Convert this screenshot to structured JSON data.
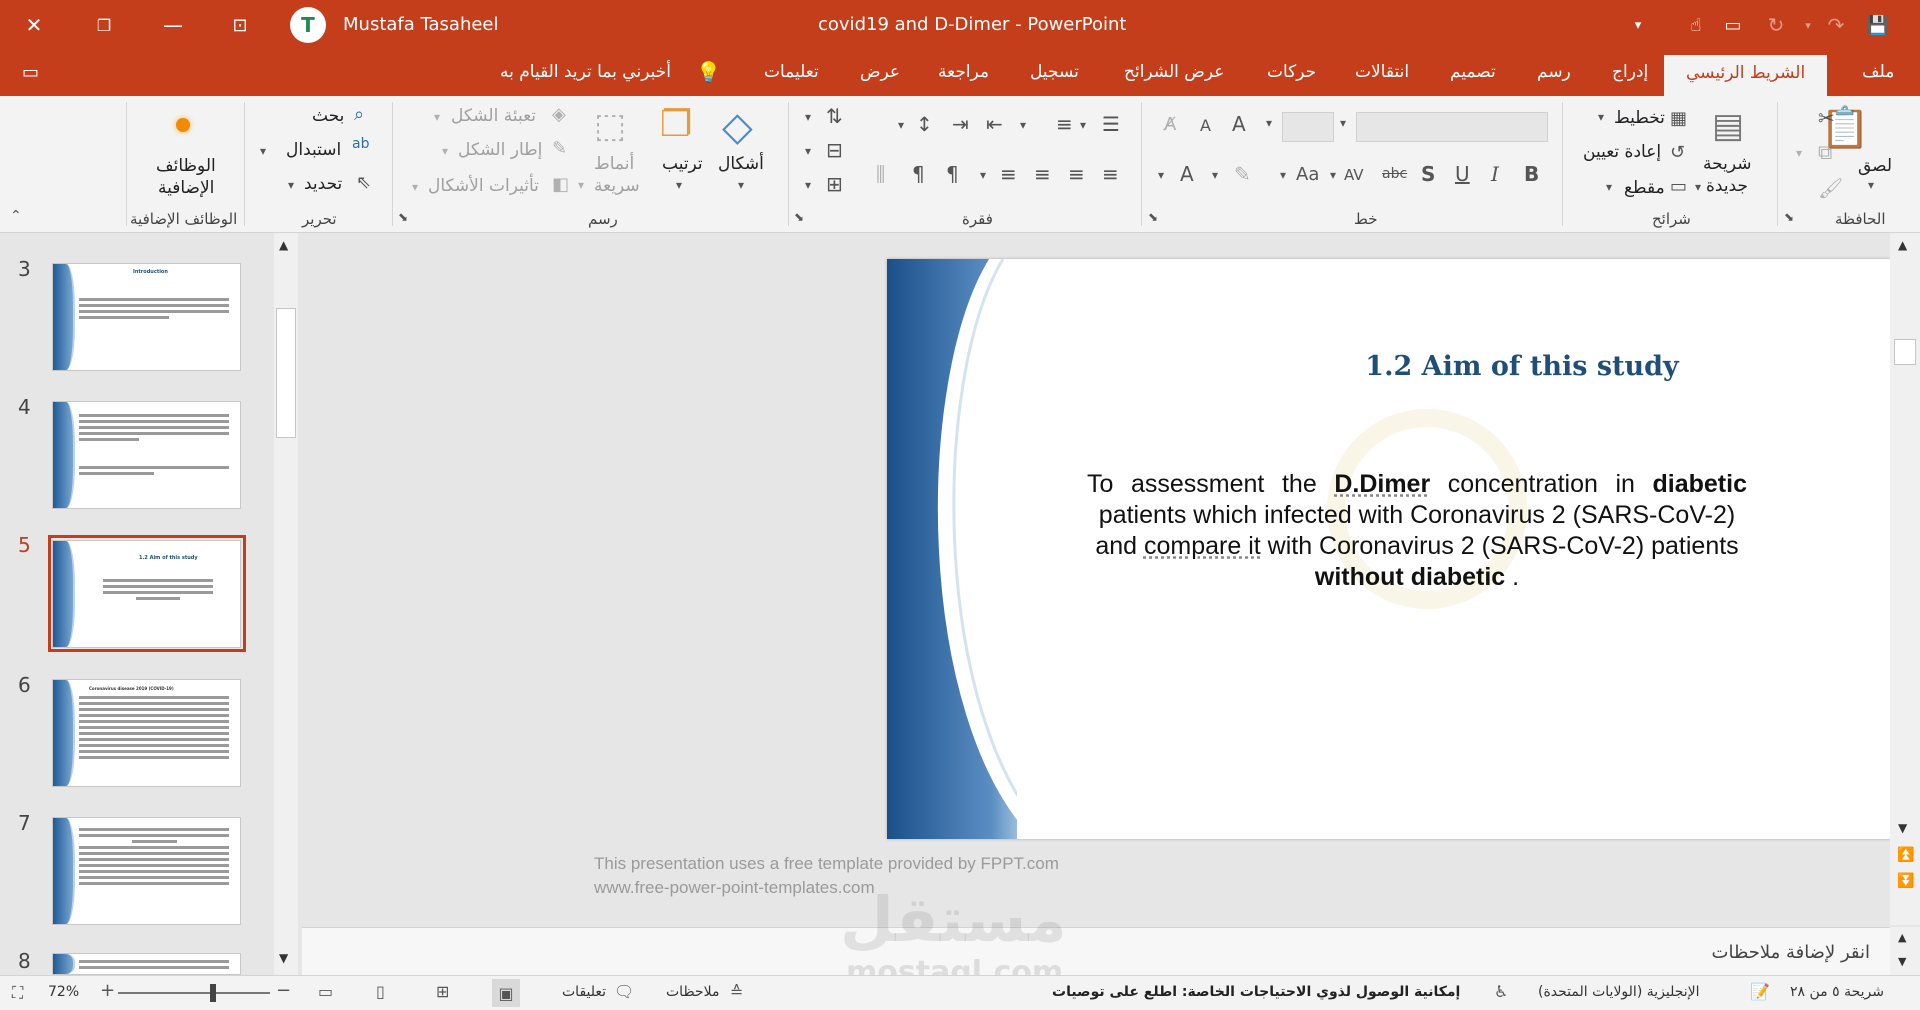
{
  "window": {
    "title": "covid19 and D-Dimer  -  PowerPoint",
    "user": "Mustafa Tasaheel"
  },
  "tabs": [
    "ملف",
    "الشريط الرئيسي",
    "إدراج",
    "رسم",
    "تصميم",
    "انتقالات",
    "حركات",
    "عرض الشرائح",
    "تسجيل",
    "مراجعة",
    "عرض",
    "تعليمات"
  ],
  "tell_me": "أخبرني بما تريد القيام به",
  "ribbon": {
    "groups": {
      "clipboard": "الحافظة",
      "slides": "شرائح",
      "font": "خط",
      "paragraph": "فقرة",
      "drawing": "رسم",
      "editing": "تحرير",
      "addins": "الوظائف الإضافية"
    },
    "paste": "لصق",
    "new_slide_1": "شريحة",
    "new_slide_2": "جديدة",
    "layout": "تخطيط",
    "reset": "إعادة تعيين",
    "section": "مقطع",
    "shapes": "أشكال",
    "arrange": "ترتيب",
    "quick_styles_1": "أنماط",
    "quick_styles_2": "سريعة",
    "shape_fill": "تعبئة الشكل",
    "shape_outline": "إطار الشكل",
    "shape_effects": "تأثيرات الأشكال",
    "find": "بحث",
    "replace": "استبدال",
    "select": "تحديد",
    "addins_1": "الوظائف",
    "addins_2": "الإضافية",
    "bold": "B",
    "italic": "I",
    "underline": "U",
    "shadow": "S",
    "strike": "abc",
    "spacing": "AV",
    "case": "Aa",
    "font_color": "A",
    "grow": "A",
    "shrink": "A"
  },
  "thumbnails": [
    {
      "num": "3",
      "title": "Introduction"
    },
    {
      "num": "4",
      "title": ""
    },
    {
      "num": "5",
      "title": "1.2 Aim of this study"
    },
    {
      "num": "6",
      "title": "Coronavirus disease 2019 (COVID-19)"
    },
    {
      "num": "7",
      "title": ""
    },
    {
      "num": "8",
      "title": ""
    }
  ],
  "slide": {
    "title": "1.2 Aim of this study",
    "body": {
      "p1": "To  assessment  the ",
      "b1": "D.Dimer",
      "p2": " concentration  in ",
      "b2": "diabetic",
      "line2": "patients which infected with Coronavirus 2 (SARS-CoV-2)",
      "l3a": "and ",
      "l3b": "compare it",
      "l3c": " with Coronavirus 2 (SARS-CoV-2) patients",
      "l4a": "without diabetic",
      "l4b": " ."
    },
    "footer_1": "This presentation uses a free template provided by FPPT.com",
    "footer_2": "www.free-power-point-templates.com"
  },
  "notes_placeholder": "انقر لإضافة ملاحظات",
  "watermark": {
    "arabic": "مستقل",
    "latin": "mostaql.com"
  },
  "status": {
    "slide_of": "شريحة ٥ من ٢٨",
    "language": "الإنجليزية (الولايات المتحدة)",
    "accessibility": "إمكانية الوصول لذوي الاحتياجات الخاصة: اطلع على توصيات",
    "notes": "ملاحظات",
    "comments": "تعليقات",
    "zoom": "72%"
  },
  "colors": {
    "accent": "#c43e1c",
    "slide_title": "#1f4e79"
  }
}
